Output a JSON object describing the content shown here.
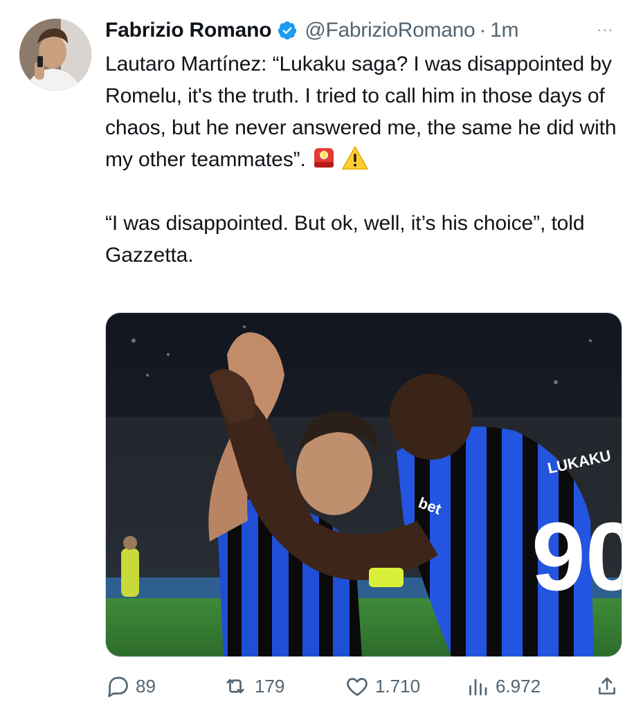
{
  "tweet": {
    "author_name": "Fabrizio Romano",
    "handle": "@FabrizioRomano",
    "separator": "·",
    "time": "1m",
    "more_label": "···",
    "paragraph_1": "Lautaro Martínez: “Lukaku saga? I was disappointed by Romelu, it's the truth. I tried to call him in those days of chaos, but he never answered me, the same he did with my other teammates”.",
    "paragraph_2": "“I was disappointed. But ok, well, it’s his choice”, told Gazzetta.",
    "emojis": [
      "police-light-emoji",
      "warning-emoji"
    ],
    "media": {
      "jersey_number": "90",
      "sponsor_text": "bet",
      "jersey_name": "LUKAKU"
    }
  },
  "actions": {
    "replies": "89",
    "retweets": "179",
    "likes": "1.710",
    "views": "6.972"
  },
  "colors": {
    "text": "#0f1419",
    "secondary": "#536471",
    "verified": "#1d9bf0",
    "inter_blue": "#1f4fd6",
    "inter_black": "#0a0a0a"
  }
}
